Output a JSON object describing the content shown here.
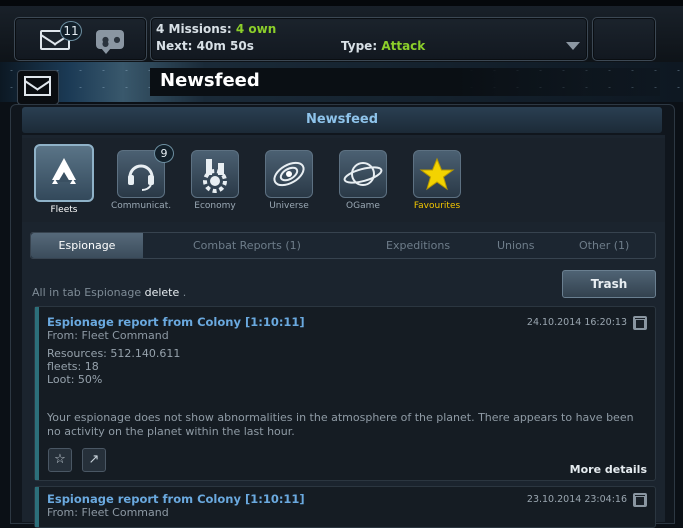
{
  "top": {
    "mail_count": "11",
    "missions_label": "4 Missions:",
    "missions_own": "4 own",
    "next_label": "Next:",
    "next_time": "40m 50s",
    "type_label": "Type:",
    "type_value": "Attack"
  },
  "banner": {
    "title": "Newsfeed"
  },
  "newsfeed_header": "Newsfeed",
  "categories": [
    {
      "label": "Fleets",
      "icon": "fleets-icon",
      "active": true
    },
    {
      "label": "Communicat...",
      "icon": "headset-icon",
      "badge": "9"
    },
    {
      "label": "Economy",
      "icon": "factory-gear-icon"
    },
    {
      "label": "Universe",
      "icon": "galaxy-icon"
    },
    {
      "label": "OGame",
      "icon": "planet-icon"
    },
    {
      "label": "Favourites",
      "icon": "star-icon"
    }
  ],
  "tabs": [
    {
      "label": "Espionage",
      "active": true
    },
    {
      "label": "Combat Reports (1)"
    },
    {
      "label": "Expeditions"
    },
    {
      "label": "Unions"
    },
    {
      "label": "Other (1)"
    }
  ],
  "all_in_tab": "All in tab Espionage",
  "delete_label": "delete",
  "all_in_suffix": ".",
  "trash_label": "Trash",
  "messages": [
    {
      "title": "Espionage report from Colony [1:10:11]",
      "from": "From: Fleet Command",
      "date": "24.10.2014 16:20:13",
      "resources": "Resources: 512.140.611",
      "fleets": "fleets: 18",
      "loot": "Loot: 50%",
      "description": "Your espionage does not show abnormalities in the atmosphere of the planet. There appears to have been no activity on the planet within the last hour.",
      "more": "More details"
    },
    {
      "title": "Espionage report from Colony [1:10:11]",
      "from": "From: Fleet Command",
      "date": "23.10.2014 23:04:16"
    }
  ]
}
